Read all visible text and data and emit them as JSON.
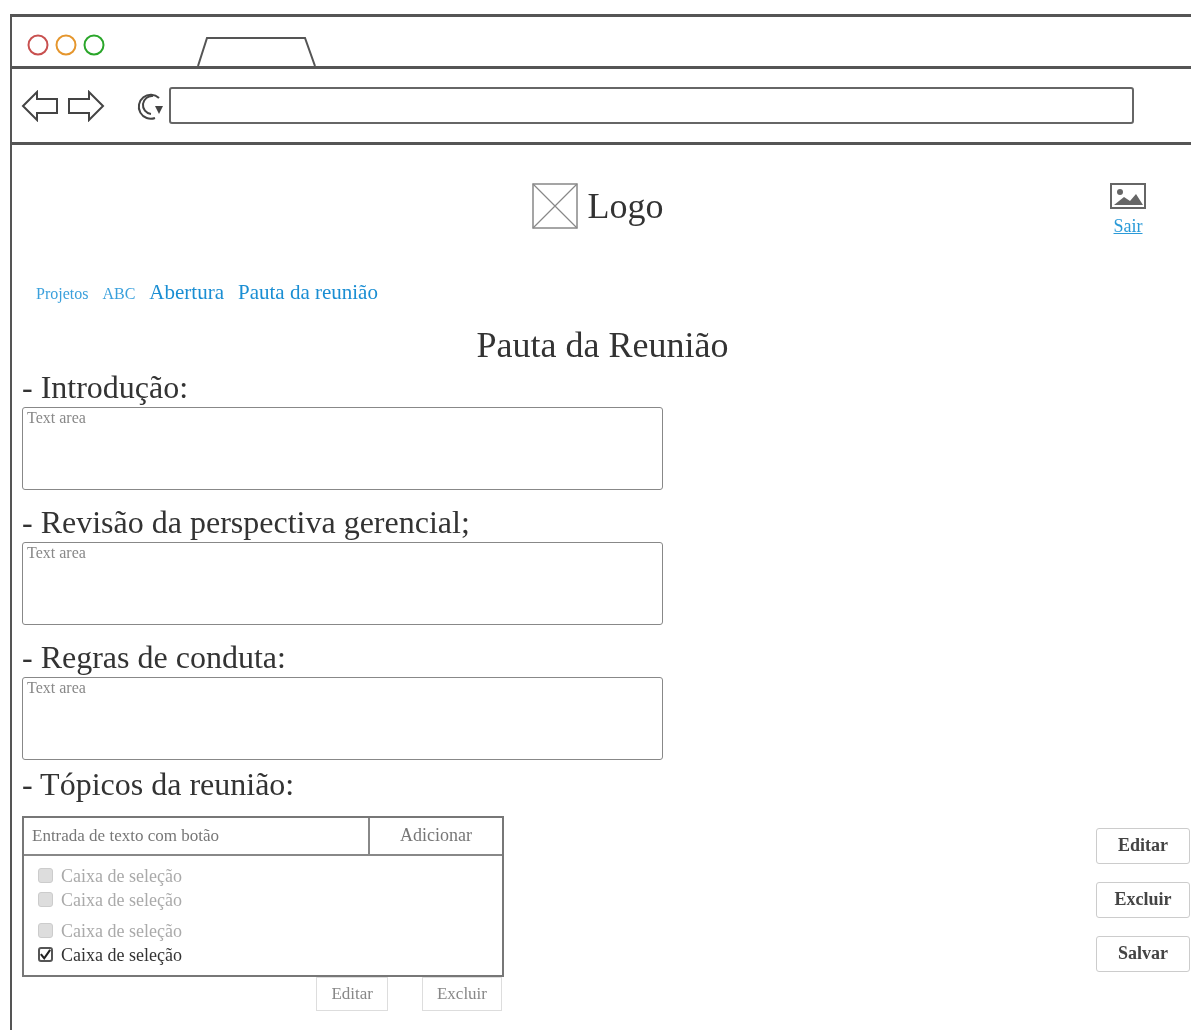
{
  "header": {
    "logo": "Logo",
    "user_link": "Sair"
  },
  "breadcrumbs": [
    {
      "label": "Projetos",
      "kind": "minor"
    },
    {
      "label": "ABC",
      "kind": "minor"
    },
    {
      "label": "Abertura",
      "kind": "major"
    },
    {
      "label": "Pauta da reunião",
      "kind": "major"
    }
  ],
  "title": "Pauta da Reunião",
  "sections": [
    {
      "heading": "- Introdução:",
      "placeholder": "Text area"
    },
    {
      "heading": "- Revisão da perspectiva gerencial;",
      "placeholder": "Text area"
    },
    {
      "heading": "- Regras de conduta:",
      "placeholder": "Text area"
    }
  ],
  "topics": {
    "heading": "- Tópicos da reunião:",
    "input_placeholder": "Entrada de texto com botão",
    "add_button": "Adicionar",
    "items": [
      {
        "label": "Caixa de seleção",
        "checked": false
      },
      {
        "label": "Caixa de seleção",
        "checked": false
      },
      {
        "label": "Caixa de seleção",
        "checked": false
      },
      {
        "label": "Caixa de seleção",
        "checked": true
      }
    ],
    "buttons": [
      "Editar",
      "Excluir"
    ]
  },
  "side_buttons": [
    "Editar",
    "Excluir",
    "Salvar"
  ]
}
